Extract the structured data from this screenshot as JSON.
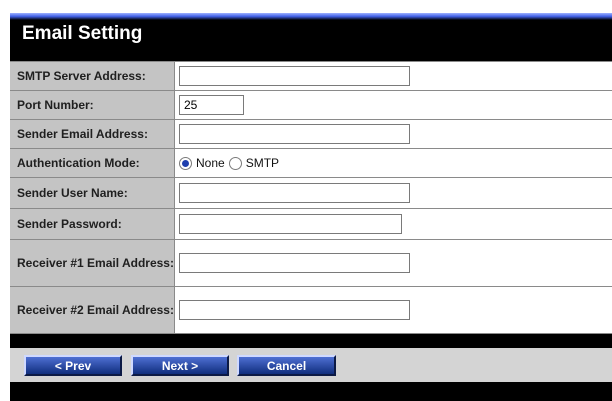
{
  "page": {
    "title": "Email Setting"
  },
  "form": {
    "smtp_server": {
      "label": "SMTP Server Address:",
      "value": ""
    },
    "port": {
      "label": "Port Number:",
      "value": "25"
    },
    "sender_email": {
      "label": "Sender Email Address:",
      "value": ""
    },
    "auth_mode": {
      "label": "Authentication Mode:",
      "options": [
        "None",
        "SMTP"
      ],
      "selected": "None"
    },
    "sender_user": {
      "label": "Sender User Name:",
      "value": ""
    },
    "sender_password": {
      "label": "Sender Password:",
      "value": ""
    },
    "receiver1": {
      "label": "Receiver #1 Email Address:",
      "value": ""
    },
    "receiver2": {
      "label": "Receiver #2 Email Address:",
      "value": ""
    }
  },
  "buttons": {
    "prev": "< Prev",
    "next": "Next >",
    "cancel": "Cancel"
  },
  "colors": {
    "panel": "#000000",
    "label_bg": "#c4c4c4",
    "button": "#1f3fae"
  }
}
